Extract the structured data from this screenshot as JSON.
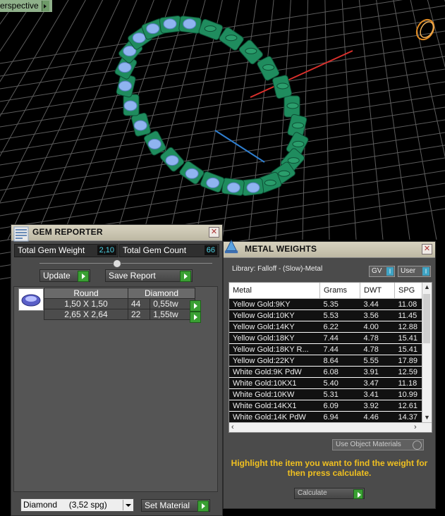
{
  "viewport": {
    "label": "erspective",
    "colors": {
      "grid": "#5c5c5c",
      "gem_metal": "#1f8c5e",
      "stone": "#8fb4f0",
      "axis_x": "#d9302c",
      "axis_y": "#2f7fd0"
    }
  },
  "gem_reporter": {
    "title": "GEM REPORTER",
    "total_weight_label": "Total Gem Weight",
    "total_weight_value": "2,10",
    "total_count_label": "Total Gem Count",
    "total_count_value": "66",
    "update_label": "Update",
    "save_report_label": "Save Report",
    "table": {
      "headers": [
        "Round",
        "Diamond"
      ],
      "rows": [
        {
          "size": "1,50 X 1,50",
          "count": "44",
          "tw": "0,55tw"
        },
        {
          "size": "2,65 X 2,64",
          "count": "22",
          "tw": "1,55tw"
        }
      ]
    },
    "material_select": "Diamond     (3,52 spg)",
    "set_material_label": "Set Material"
  },
  "metal_weights": {
    "title": "METAL WEIGHTS",
    "library": "Library: Falloff - (Slow)-Metal",
    "gv_label": "GV",
    "user_label": "User",
    "toggle_value": "I",
    "columns": [
      "Metal",
      "Grams",
      "DWT",
      "SPG"
    ],
    "rows": [
      [
        "Yellow Gold:9KY",
        "5.35",
        "3.44",
        "11.08"
      ],
      [
        "Yellow Gold:10KY",
        "5.53",
        "3.56",
        "11.45"
      ],
      [
        "Yellow Gold:14KY",
        "6.22",
        "4.00",
        "12.88"
      ],
      [
        "Yellow Gold:18KY",
        "7.44",
        "4.78",
        "15.41"
      ],
      [
        "Yellow Gold:18KY R...",
        "7.44",
        "4.78",
        "15.41"
      ],
      [
        "Yellow Gold:22KY",
        "8.64",
        "5.55",
        "17.89"
      ],
      [
        "White Gold:9K PdW",
        "6.08",
        "3.91",
        "12.59"
      ],
      [
        "White Gold:10KX1",
        "5.40",
        "3.47",
        "11.18"
      ],
      [
        "White Gold:10KW",
        "5.31",
        "3.41",
        "10.99"
      ],
      [
        "White Gold:14KX1",
        "6.09",
        "3.92",
        "12.61"
      ],
      [
        "White Gold:14K PdW",
        "6.94",
        "4.46",
        "14.37"
      ]
    ],
    "use_object_materials": "Use Object Materials",
    "hint": "Highlight the item you want to find the weight for then press calculate.",
    "calculate_label": "Calculate"
  }
}
